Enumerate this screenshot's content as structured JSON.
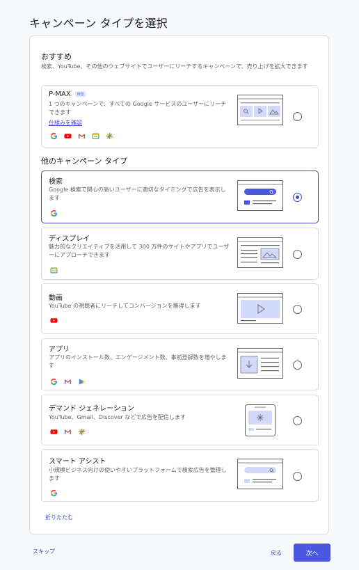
{
  "page": {
    "title": "キャンペーン タイプを選択"
  },
  "recommended": {
    "title": "おすすめ",
    "description": "検索、YouTube、その他のウェブサイトでユーザーにリーチするキャンペーンで、売り上げを拡大できます"
  },
  "pmax": {
    "title": "P-MAX",
    "badge": "推奨",
    "description": "1 つのキャンペーンで、すべての Google サービスのユーザーにリーチできます",
    "link": "仕組みを確認",
    "icons": [
      "google-icon",
      "youtube-icon",
      "gmail-icon",
      "display-icon",
      "discover-icon"
    ],
    "selected": false
  },
  "other": {
    "title": "他のキャンペーン タイプ"
  },
  "search": {
    "title": "検索",
    "description": "Google 検索で関心の高いユーザーに適切なタイミングで広告を表示します",
    "icons": [
      "google-icon"
    ],
    "selected": true
  },
  "display": {
    "title": "ディスプレイ",
    "description": "魅力的なクリエイティブを活用して 300 万件のサイトやアプリでユーザーにアプローチできます",
    "icons": [
      "display-icon"
    ],
    "selected": false
  },
  "video": {
    "title": "動画",
    "description": "YouTube の視聴者にリーチしてコンバージョンを獲得します",
    "icons": [
      "youtube-icon"
    ],
    "selected": false
  },
  "app": {
    "title": "アプリ",
    "description": "アプリのインストール数、エンゲージメント数、事前登録数を増やします",
    "icons": [
      "google-icon",
      "gmail-icon",
      "play-icon"
    ],
    "selected": false
  },
  "demandgen": {
    "title": "デマンド ジェネレーション",
    "description": "YouTube、Gmail、Discover などで広告を配信します",
    "icons": [
      "youtube-icon",
      "gmail-icon",
      "discover-icon"
    ],
    "selected": false
  },
  "smart": {
    "title": "スマート アシスト",
    "description": "小規模ビジネス向けの使いやすいプラットフォームで検索広告を管理します",
    "icons": [
      "google-icon"
    ],
    "selected": false
  },
  "footer": {
    "collapse": "折りたたむ",
    "skip": "スキップ",
    "back": "戻る",
    "next": "次へ"
  },
  "colors": {
    "accent": "#3c4cc9",
    "primary_button": "#4a58e0"
  }
}
